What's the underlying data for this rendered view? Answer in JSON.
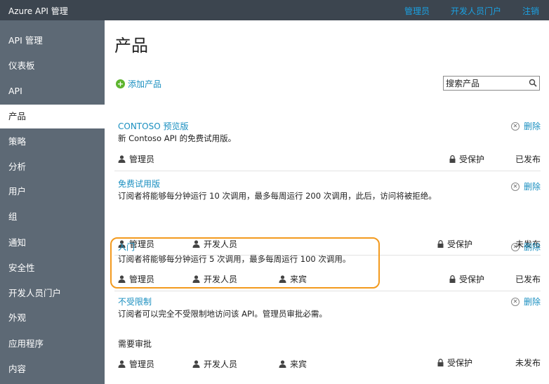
{
  "topbar": {
    "title": "Azure API 管理",
    "links": [
      "管理员",
      "开发人员门户",
      "注销"
    ]
  },
  "sidebar": {
    "items": [
      {
        "label": "API 管理",
        "active": false
      },
      {
        "label": "仪表板",
        "active": false
      },
      {
        "label": "API",
        "active": false
      },
      {
        "label": "产品",
        "active": true
      },
      {
        "label": "策略",
        "active": false
      },
      {
        "label": "分析",
        "active": false
      },
      {
        "label": "用户",
        "active": false
      },
      {
        "label": "组",
        "active": false
      },
      {
        "label": "通知",
        "active": false
      },
      {
        "label": "安全性",
        "active": false
      },
      {
        "label": "开发人员门户",
        "active": false
      },
      {
        "label": "外观",
        "active": false
      },
      {
        "label": "应用程序",
        "active": false
      },
      {
        "label": "内容",
        "active": false
      }
    ]
  },
  "main": {
    "page_title": "产品",
    "add_product": "添加产品",
    "search_placeholder": "搜索产品",
    "products": [
      {
        "name": "CONTOSO 预览版",
        "description": "新 Contoso API 的免费试用版。",
        "delete_label": "删除",
        "groups": [
          "管理员"
        ],
        "protection": "受保护",
        "status": "已发布"
      },
      {
        "name": "免费试用版",
        "description": "订阅者将能够每分钟运行 10 次调用，最多每周运行 200 次调用，此后，访问将被拒绝。",
        "delete_label": "删除",
        "groups": [
          "管理员",
          "开发人员"
        ],
        "protection": "受保护",
        "status": "未发布"
      },
      {
        "name": "入门",
        "description": "订阅者将能够每分钟运行 5 次调用，最多每周运行 100 次调用。",
        "delete_label": "删除",
        "groups": [
          "管理员",
          "开发人员",
          "来宾"
        ],
        "protection": "受保护",
        "status": "已发布"
      },
      {
        "name": "不受限制",
        "description": "订阅者可以完全不受限制地访问该 API。管理员审批必需。",
        "approval_label": "需要审批",
        "delete_label": "删除",
        "groups": [
          "管理员",
          "开发人员",
          "来宾"
        ],
        "protection": "受保护",
        "status": "未发布"
      }
    ]
  },
  "colors": {
    "topbar": "#3c454f",
    "sidebar": "#5d6975",
    "link": "#1a8fc0",
    "highlight": "#f39a1e",
    "add_icon": "#5db52f"
  }
}
